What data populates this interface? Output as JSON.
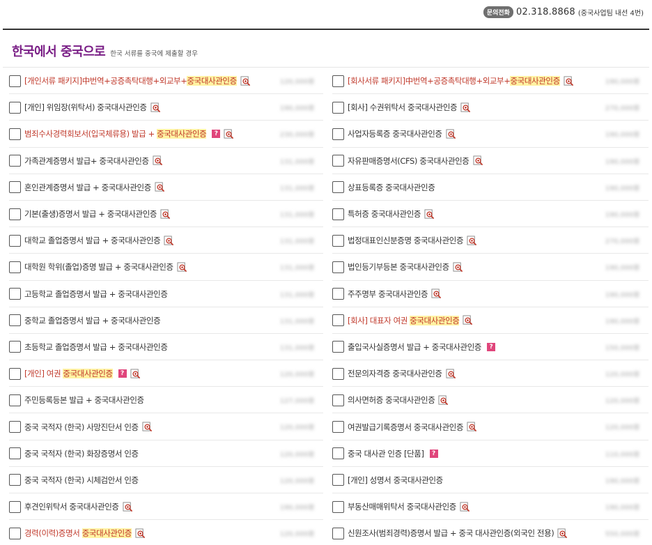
{
  "contact": {
    "badge": "문의전화",
    "number": "02.318.8868",
    "note": "(중국사업팀 내선 4번)"
  },
  "section": {
    "title": "한국에서 중국으로",
    "subtitle": "한국 서류를 중국에 제출할 경우"
  },
  "colors": {
    "title": "#7a1f86",
    "highlight_text": "#c0392b",
    "highlight_bg": "#fff3a3",
    "help_badge": "#e0457b"
  },
  "icons": {
    "zoom": "magnifier-plus-icon",
    "help": "question-badge-icon"
  },
  "help_badge_text": "?",
  "left_items": [
    {
      "parts": [
        "[개인서류 패키지]中번역+공증촉탁대행+외교부+",
        "중국대사관인증"
      ],
      "hl": [
        false,
        true
      ],
      "red": true,
      "help": false,
      "zoom": true,
      "price": "120,000원"
    },
    {
      "parts": [
        "[개인] 위임장(위탁서) 중국대사관인증"
      ],
      "hl": [
        false
      ],
      "red": false,
      "help": false,
      "zoom": true,
      "price": "190,000원"
    },
    {
      "parts": [
        "범죄수사경력회보서(입국체류용) 발급 + ",
        "중국대사관인증"
      ],
      "hl": [
        false,
        true
      ],
      "red": true,
      "help": true,
      "zoom": true,
      "price": "230,000원"
    },
    {
      "parts": [
        "가족관계증명서 발급+ 중국대사관인증"
      ],
      "hl": [
        false
      ],
      "red": false,
      "help": false,
      "zoom": true,
      "price": "131,000원"
    },
    {
      "parts": [
        "혼인관계증명서 발급 + 중국대사관인증"
      ],
      "hl": [
        false
      ],
      "red": false,
      "help": false,
      "zoom": true,
      "price": "131,000원"
    },
    {
      "parts": [
        "기본(출생)증명서 발급 + 중국대사관인증"
      ],
      "hl": [
        false
      ],
      "red": false,
      "help": false,
      "zoom": true,
      "price": "131,000원"
    },
    {
      "parts": [
        "대학교 졸업증명서 발급 + 중국대사관인증"
      ],
      "hl": [
        false
      ],
      "red": false,
      "help": false,
      "zoom": true,
      "price": "131,000원"
    },
    {
      "parts": [
        "대학원 학위(졸업)증명 발급 + 중국대사관인증"
      ],
      "hl": [
        false
      ],
      "red": false,
      "help": false,
      "zoom": true,
      "price": "131,000원"
    },
    {
      "parts": [
        "고등학교 졸업증명서 발급 + 중국대사관인증"
      ],
      "hl": [
        false
      ],
      "red": false,
      "help": false,
      "zoom": false,
      "price": "131,000원"
    },
    {
      "parts": [
        "중학교 졸업증명서 발급 + 중국대사관인증"
      ],
      "hl": [
        false
      ],
      "red": false,
      "help": false,
      "zoom": false,
      "price": "131,000원"
    },
    {
      "parts": [
        "초등학교 졸업증명서 발급 + 중국대사관인증"
      ],
      "hl": [
        false
      ],
      "red": false,
      "help": false,
      "zoom": false,
      "price": "131,000원"
    },
    {
      "parts": [
        "[개인] 여권 ",
        "중국대사관인증"
      ],
      "hl": [
        false,
        true
      ],
      "red": true,
      "help": true,
      "zoom": true,
      "price": "120,000원"
    },
    {
      "parts": [
        "주민등록등본 발급 + 중국대사관인증"
      ],
      "hl": [
        false
      ],
      "red": false,
      "help": false,
      "zoom": false,
      "price": "127,000원"
    },
    {
      "parts": [
        "중국 국적자 (한국) 사망진단서 인증"
      ],
      "hl": [
        false
      ],
      "red": false,
      "help": false,
      "zoom": true,
      "price": "120,000원"
    },
    {
      "parts": [
        "중국 국적자 (한국) 화장증명서 인증"
      ],
      "hl": [
        false
      ],
      "red": false,
      "help": false,
      "zoom": false,
      "price": "120,000원"
    },
    {
      "parts": [
        "중국 국적자 (한국) 시체검안서 인증"
      ],
      "hl": [
        false
      ],
      "red": false,
      "help": false,
      "zoom": false,
      "price": "120,000원"
    },
    {
      "parts": [
        "후견인위탁서 중국대사관인증"
      ],
      "hl": [
        false
      ],
      "red": false,
      "help": false,
      "zoom": true,
      "price": "190,000원"
    },
    {
      "parts": [
        "경력(이력)증명서 ",
        "중국대사관인증"
      ],
      "hl": [
        false,
        true
      ],
      "red": true,
      "help": false,
      "zoom": true,
      "price": "120,000원"
    }
  ],
  "right_items": [
    {
      "parts": [
        "[회사서류 패키지]中번역+공증촉탁대행+외교부+",
        "중국대사관인증"
      ],
      "hl": [
        false,
        true
      ],
      "red": true,
      "help": false,
      "zoom": true,
      "price": "190,000원"
    },
    {
      "parts": [
        "[회사] 수권위탁서 중국대사관인증"
      ],
      "hl": [
        false
      ],
      "red": false,
      "help": false,
      "zoom": true,
      "price": "270,000원"
    },
    {
      "parts": [
        "사업자등록증 중국대사관인증"
      ],
      "hl": [
        false
      ],
      "red": false,
      "help": false,
      "zoom": true,
      "price": "190,000원"
    },
    {
      "parts": [
        "자유판매증명서(CFS) 중국대사관인증"
      ],
      "hl": [
        false
      ],
      "red": false,
      "help": false,
      "zoom": true,
      "price": "190,000원"
    },
    {
      "parts": [
        "상표등록증 중국대사관인증"
      ],
      "hl": [
        false
      ],
      "red": false,
      "help": false,
      "zoom": false,
      "price": "190,000원"
    },
    {
      "parts": [
        "특허증 중국대사관인증"
      ],
      "hl": [
        false
      ],
      "red": false,
      "help": false,
      "zoom": true,
      "price": "190,000원"
    },
    {
      "parts": [
        "법정대표인신분증명 중국대사관인증"
      ],
      "hl": [
        false
      ],
      "red": false,
      "help": false,
      "zoom": true,
      "price": "270,000원"
    },
    {
      "parts": [
        "법인등기부등본 중국대사관인증"
      ],
      "hl": [
        false
      ],
      "red": false,
      "help": false,
      "zoom": true,
      "price": "190,000원"
    },
    {
      "parts": [
        "주주명부 중국대사관인증"
      ],
      "hl": [
        false
      ],
      "red": false,
      "help": false,
      "zoom": true,
      "price": "190,000원"
    },
    {
      "parts": [
        "[회사] 대표자 여권 ",
        "중국대사관인증"
      ],
      "hl": [
        false,
        true
      ],
      "red": true,
      "help": false,
      "zoom": true,
      "price": "190,000원"
    },
    {
      "parts": [
        "출입국사실증명서 발급 + 중국대사관인증"
      ],
      "hl": [
        false
      ],
      "red": false,
      "help": true,
      "zoom": false,
      "price": "150,000원"
    },
    {
      "parts": [
        "전문의자격증 중국대사관인증"
      ],
      "hl": [
        false
      ],
      "red": false,
      "help": false,
      "zoom": true,
      "price": "120,000원"
    },
    {
      "parts": [
        "의사면허증 중국대사관인증"
      ],
      "hl": [
        false
      ],
      "red": false,
      "help": false,
      "zoom": true,
      "price": "120,000원"
    },
    {
      "parts": [
        "여권발급기록증명서 중국대사관인증"
      ],
      "hl": [
        false
      ],
      "red": false,
      "help": false,
      "zoom": true,
      "price": "120,000원"
    },
    {
      "parts": [
        "중국 대사관 인증 [단품]"
      ],
      "hl": [
        false
      ],
      "red": false,
      "help": true,
      "zoom": false,
      "price": "110,000원"
    },
    {
      "parts": [
        "[개인] 성명서 중국대사관인증"
      ],
      "hl": [
        false
      ],
      "red": false,
      "help": false,
      "zoom": false,
      "price": "190,000원"
    },
    {
      "parts": [
        "부동산매매위탁서 중국대사관인증"
      ],
      "hl": [
        false
      ],
      "red": false,
      "help": false,
      "zoom": true,
      "price": "190,000원"
    },
    {
      "parts": [
        "신원조사(범죄경력)증명서 발급 + 중국 대사관인증(외국인 전용)"
      ],
      "hl": [
        false
      ],
      "red": false,
      "help": false,
      "zoom": true,
      "price": "550,000원"
    }
  ]
}
